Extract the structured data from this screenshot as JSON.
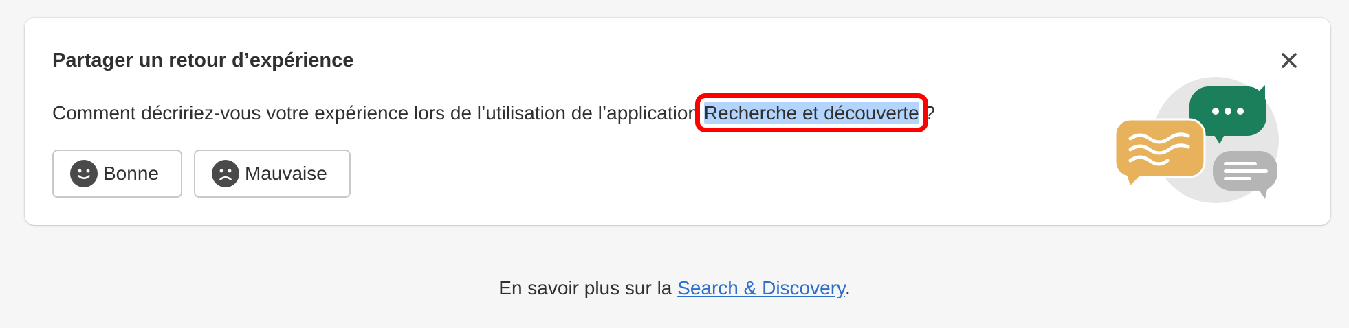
{
  "card": {
    "title": "Partager un retour d’expérience",
    "question_prefix": "Comment décririez-vous votre expérience lors de l’utilisation de l’application ",
    "app_name": "Recherche et découverte",
    "question_suffix": " ?",
    "buttons": {
      "good_label": "Bonne",
      "bad_label": "Mauvaise"
    },
    "close_icon": "close-icon",
    "illustration_icon": "chat-bubbles-illustration"
  },
  "footer": {
    "prefix": "En savoir plus sur la ",
    "link_text": "Search & Discovery",
    "suffix": "."
  },
  "colors": {
    "background": "#f6f6f6",
    "card": "#ffffff",
    "text": "#303030",
    "link": "#2c6ecb",
    "selection": "#b3d4fc",
    "annotation_box": "#ff0000",
    "bubble_green": "#1a7f5a",
    "bubble_orange": "#e8b25c",
    "bubble_gray": "#b5b5b5",
    "circle_gray": "#e6e6e6"
  }
}
